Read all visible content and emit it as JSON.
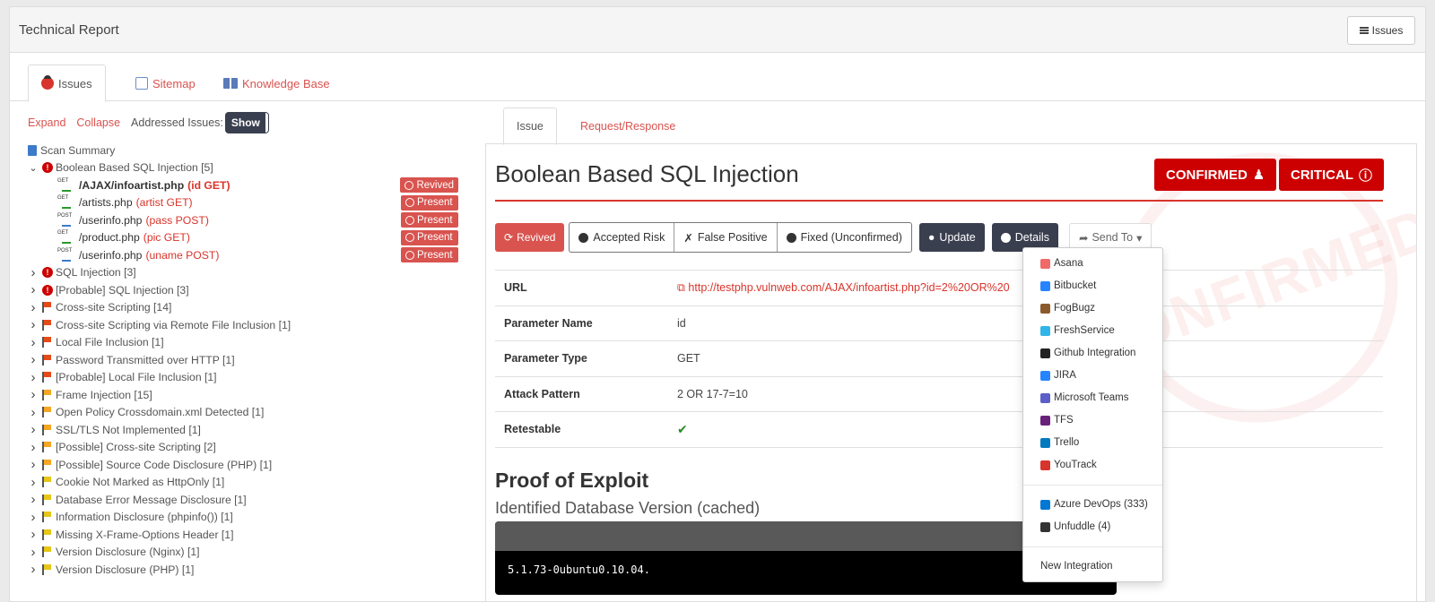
{
  "header": {
    "title": "Technical Report",
    "issues_button": "Issues"
  },
  "main_tabs": [
    {
      "label": "Issues",
      "icon": "bug-icon"
    },
    {
      "label": "Sitemap",
      "icon": "sitemap-icon"
    },
    {
      "label": "Knowledge Base",
      "icon": "book-icon"
    }
  ],
  "toolbar": {
    "expand": "Expand",
    "collapse": "Collapse",
    "addressed_label": "Addressed Issues:",
    "show": "Show"
  },
  "tree": {
    "scan_summary": "Scan Summary",
    "boolean_group": "Boolean Based SQL Injection [5]",
    "children": [
      {
        "method": "GET",
        "path": "/AJAX/infoartist.php",
        "param": "(id GET)",
        "status": "Revived",
        "bold": true
      },
      {
        "method": "GET",
        "path": "/artists.php",
        "param": "(artist GET)",
        "status": "Present",
        "bold": false
      },
      {
        "method": "POST",
        "path": "/userinfo.php",
        "param": "(pass POST)",
        "status": "Present",
        "bold": false
      },
      {
        "method": "GET",
        "path": "/product.php",
        "param": "(pic GET)",
        "status": "Present",
        "bold": false
      },
      {
        "method": "POST",
        "path": "/userinfo.php",
        "param": "(uname POST)",
        "status": "Present",
        "bold": false
      }
    ],
    "groups": [
      {
        "label": "SQL Injection [3]",
        "icon": "critical"
      },
      {
        "label": "[Probable] SQL Injection [3]",
        "icon": "critical"
      },
      {
        "label": "Cross-site Scripting [14]",
        "icon": "high"
      },
      {
        "label": "Cross-site Scripting via Remote File Inclusion [1]",
        "icon": "high"
      },
      {
        "label": "Local File Inclusion [1]",
        "icon": "high"
      },
      {
        "label": "Password Transmitted over HTTP [1]",
        "icon": "high"
      },
      {
        "label": "[Probable] Local File Inclusion [1]",
        "icon": "high"
      },
      {
        "label": "Frame Injection [15]",
        "icon": "medium"
      },
      {
        "label": "Open Policy Crossdomain.xml Detected [1]",
        "icon": "medium"
      },
      {
        "label": "SSL/TLS Not Implemented [1]",
        "icon": "medium"
      },
      {
        "label": "[Possible] Cross-site Scripting [2]",
        "icon": "medium"
      },
      {
        "label": "[Possible] Source Code Disclosure (PHP) [1]",
        "icon": "medium"
      },
      {
        "label": "Cookie Not Marked as HttpOnly [1]",
        "icon": "low"
      },
      {
        "label": "Database Error Message Disclosure [1]",
        "icon": "low"
      },
      {
        "label": "Information Disclosure (phpinfo()) [1]",
        "icon": "low"
      },
      {
        "label": "Missing X-Frame-Options Header [1]",
        "icon": "low"
      },
      {
        "label": "Version Disclosure (Nginx) [1]",
        "icon": "low"
      },
      {
        "label": "Version Disclosure (PHP) [1]",
        "icon": "low"
      }
    ]
  },
  "detail_tabs": [
    "Issue",
    "Request/Response"
  ],
  "issue": {
    "title": "Boolean Based SQL Injection",
    "confirmed": "CONFIRMED",
    "critical": "CRITICAL",
    "watermark": "CONFIRMED",
    "actions": {
      "revived": "Revived",
      "accepted_risk": "Accepted Risk",
      "false_positive": "False Positive",
      "fixed": "Fixed (Unconfirmed)",
      "update": "Update",
      "details": "Details",
      "send_to": "Send To"
    },
    "rows": [
      {
        "label": "URL",
        "value": "http://testphp.vulnweb.com/AJAX/infoartist.php?id=2%20OR%20"
      },
      {
        "label": "Parameter Name",
        "value": "id"
      },
      {
        "label": "Parameter Type",
        "value": "GET"
      },
      {
        "label": "Attack Pattern",
        "value": "2 OR 17-7=10"
      },
      {
        "label": "Retestable",
        "value": "✔"
      }
    ],
    "proof_title": "Proof of Exploit",
    "proof_subtitle": "Identified Database Version (cached)",
    "proof_value": "5.1.73-0ubuntu0.10.04."
  },
  "send_to_menu": {
    "integrations": [
      {
        "label": "Asana",
        "color": "#f06a6a"
      },
      {
        "label": "Bitbucket",
        "color": "#2684ff"
      },
      {
        "label": "FogBugz",
        "color": "#8b5a2b"
      },
      {
        "label": "FreshService",
        "color": "#2fb5e8"
      },
      {
        "label": "Github Integration",
        "color": "#222222"
      },
      {
        "label": "JIRA",
        "color": "#2684ff"
      },
      {
        "label": "Microsoft Teams",
        "color": "#5b5fc7"
      },
      {
        "label": "TFS",
        "color": "#68217a"
      },
      {
        "label": "Trello",
        "color": "#0079bf"
      },
      {
        "label": "YouTrack",
        "color": "#d9342b"
      }
    ],
    "extras": [
      {
        "label": "Azure DevOps (333)",
        "color": "#0078d4"
      },
      {
        "label": "Unfuddle (4)",
        "color": "#333333"
      }
    ],
    "new_integration": "New Integration"
  },
  "colors": {
    "accent": "#d9534f",
    "critical": "#cc0000",
    "dark": "#3a3f4f",
    "high": "#e64a19",
    "medium": "#f5a623",
    "low": "#e6c619"
  }
}
